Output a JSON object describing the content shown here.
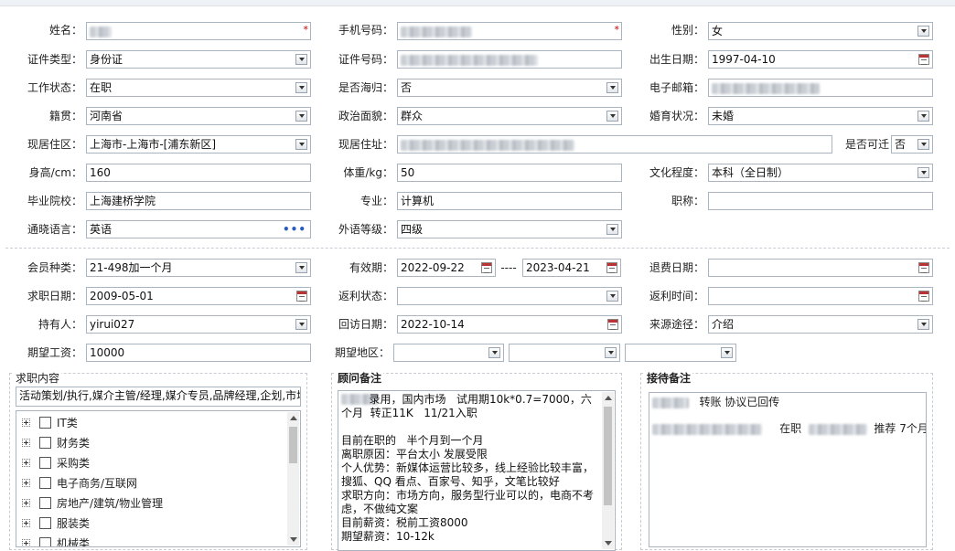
{
  "form": {
    "name": {
      "label": "姓名：",
      "value": ""
    },
    "phone": {
      "label": "手机号码：",
      "value": ""
    },
    "gender": {
      "label": "性别：",
      "value": "女"
    },
    "id_type": {
      "label": "证件类型：",
      "value": "身份证"
    },
    "id_number": {
      "label": "证件号码：",
      "value": ""
    },
    "birthdate": {
      "label": "出生日期：",
      "value": "1997-04-10"
    },
    "work_status": {
      "label": "工作状态：",
      "value": "在职"
    },
    "returnee": {
      "label": "是否海归：",
      "value": "否"
    },
    "email": {
      "label": "电子邮箱：",
      "value": ""
    },
    "native_place": {
      "label": "籍贯：",
      "value": "河南省"
    },
    "political": {
      "label": "政治面貌：",
      "value": "群众"
    },
    "marital": {
      "label": "婚育状况：",
      "value": "未婚"
    },
    "residence_area": {
      "label": "现居住区：",
      "value": "上海市-上海市-[浦东新区]"
    },
    "address": {
      "label": "现居住址：",
      "value": ""
    },
    "relocate": {
      "label": "是否可迁",
      "value": "否"
    },
    "height": {
      "label": "身高/cm：",
      "value": "160"
    },
    "weight": {
      "label": "体重/kg：",
      "value": "50"
    },
    "education": {
      "label": "文化程度：",
      "value": "本科（全日制）"
    },
    "school": {
      "label": "毕业院校：",
      "value": "上海建桥学院"
    },
    "major": {
      "label": "专业：",
      "value": "计算机"
    },
    "title": {
      "label": "职称：",
      "value": ""
    },
    "language": {
      "label": "通晓语言：",
      "value": "英语"
    },
    "foreign_level": {
      "label": "外语等级：",
      "value": "四级"
    },
    "membership": {
      "label": "会员种类：",
      "value": "21-498加一个月"
    },
    "validity": {
      "label": "有效期：",
      "from": "2022-09-22",
      "sep": "----",
      "to": "2023-04-21"
    },
    "refund_date": {
      "label": "退费日期：",
      "value": ""
    },
    "job_date": {
      "label": "求职日期：",
      "value": "2009-05-01"
    },
    "rebate_status": {
      "label": "返利状态：",
      "value": ""
    },
    "rebate_time": {
      "label": "返利时间：",
      "value": ""
    },
    "holder": {
      "label": "持有人：",
      "value": "yirui027"
    },
    "visit_date": {
      "label": "回访日期：",
      "value": "2022-10-14"
    },
    "source": {
      "label": "来源途径：",
      "value": "介绍"
    },
    "expected_salary": {
      "label": "期望工资：",
      "value": "10000"
    },
    "expected_region": {
      "label": "期望地区：",
      "values": [
        "",
        "",
        ""
      ]
    }
  },
  "job_content": {
    "title": "求职内容",
    "summary": "活动策划/执行,媒介主管/经理,媒介专员,品牌经理,企划,市场",
    "categories": [
      "IT类",
      "财务类",
      "采购类",
      "电子商务/互联网",
      "房地产/建筑/物业管理",
      "服装类",
      "机械类"
    ]
  },
  "consultant_note": {
    "title": "顾问备注",
    "text": "        录用，国内市场   试用期10k*0.7=7000，六个月  转正11K   11/21入职\n\n目前在职的   半个月到一个月\n离职原因：平台太小 发展受限\n个人优势：新媒体运营比较多，线上经验比较丰富，搜狐、QQ 看点、百家号、知乎，文笔比较好\n求职方向：市场方向，服务型行业可以的，电商不考虑，不做纯文案\n目前薪资：税前工资8000\n期望薪资：10-12k"
  },
  "reception_note": {
    "title": "接待备注",
    "line1": "转账 协议已回传",
    "line2a": "在职",
    "line2b": "推荐  7个月"
  }
}
